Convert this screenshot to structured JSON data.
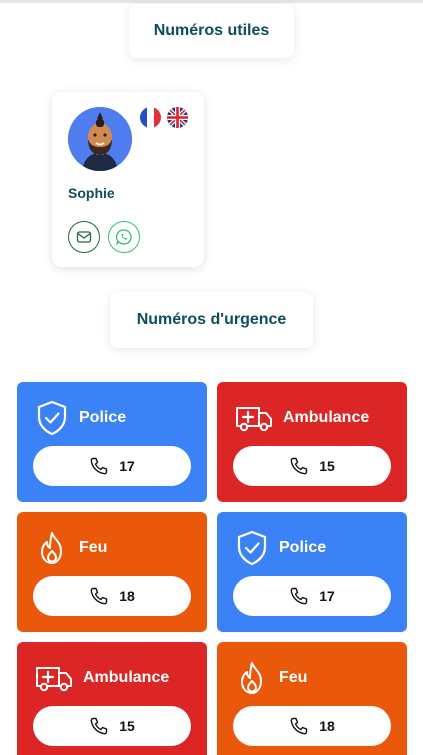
{
  "sections": {
    "useful_title": "Numéros utiles",
    "emergency_title": "Numéros d'urgence"
  },
  "contact": {
    "name": "Sophie",
    "languages": [
      "fr-flag-icon",
      "uk-flag-icon"
    ],
    "actions": [
      "mail-icon",
      "whatsapp-icon"
    ]
  },
  "colors": {
    "police": "#3b82f6",
    "ambulance": "#dc2626",
    "fire": "#ea580c",
    "title_text": "#0d4f5c"
  },
  "emergency": {
    "tiles": [
      {
        "label": "Police",
        "number": "17",
        "icon": "shield-check-icon"
      },
      {
        "label": "Ambulance",
        "number": "15",
        "icon": "ambulance-icon"
      },
      {
        "label": "Feu",
        "number": "18",
        "icon": "flame-icon"
      },
      {
        "label": "Police",
        "number": "17",
        "icon": "shield-check-icon"
      },
      {
        "label": "Ambulance",
        "number": "15",
        "icon": "ambulance-icon"
      },
      {
        "label": "Feu",
        "number": "18",
        "icon": "flame-icon"
      }
    ]
  }
}
